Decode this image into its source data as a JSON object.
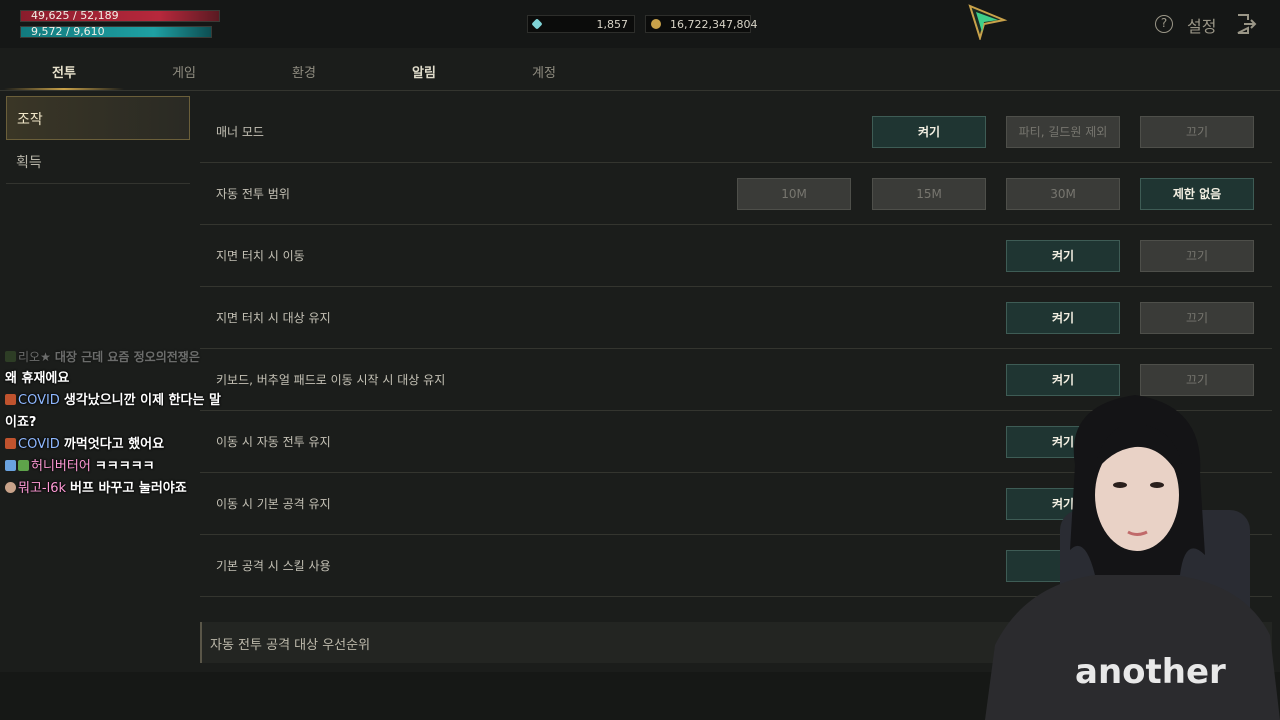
{
  "hud": {
    "hp": "49,625 / 52,189",
    "mp": "9,572 / 9,610",
    "diamonds": "1,857",
    "gold": "16,722,347,804",
    "help_glyph": "?",
    "settings_title": "설정"
  },
  "tabs": [
    "전투",
    "게임",
    "환경",
    "알림",
    "계정"
  ],
  "submenu": [
    "조작",
    "획득"
  ],
  "rows": [
    {
      "label": "매너 모드",
      "options": [
        "켜기",
        "파티, 길드원 제외",
        "끄기"
      ]
    },
    {
      "label": "자동 전투 범위",
      "options": [
        "10M",
        "15M",
        "30M",
        "제한 없음"
      ]
    },
    {
      "label": "지면 터치 시 이동",
      "options": [
        "켜기",
        "끄기"
      ]
    },
    {
      "label": "지면 터치 시 대상 유지",
      "options": [
        "켜기",
        "끄기"
      ]
    },
    {
      "label": "키보드, 버추얼 패드로 이동 시작 시 대상 유지",
      "options": [
        "켜기",
        "끄기"
      ]
    },
    {
      "label": "이동 시 자동 전투 유지",
      "options": [
        "켜기"
      ]
    },
    {
      "label": "이동 시 기본 공격 유지",
      "options": [
        "켜기"
      ]
    },
    {
      "label": "기본 공격 시 스킬 사용",
      "options": []
    }
  ],
  "section_label": "자동 전투 공격 대상 우선순위",
  "chat": [
    {
      "nick": "",
      "msg": "왜 휴재에요",
      "nick_color": "#ffffff"
    },
    {
      "nick": "COVID",
      "msg": "생각났으니깐 이제 한다는 말",
      "nick_color": "#8fb8ff"
    },
    {
      "nick": "",
      "msg": "이죠?",
      "nick_color": "#ffffff"
    },
    {
      "nick": "COVID",
      "msg": "까먹엇다고 했어요",
      "nick_color": "#8fb8ff"
    },
    {
      "nick": "허니버터어",
      "msg": "ㅋㅋㅋㅋㅋ",
      "nick_color": "#ff9ad6"
    },
    {
      "nick": "뭐고-l6k",
      "msg": "버프 바꾸고 눌러야죠",
      "nick_color": "#ff9ad6"
    }
  ],
  "chat_faded": {
    "nick": "리오★",
    "msg": "대장 근데 요즘 정오의전쟁은"
  },
  "shirt_text": "another",
  "colors": {
    "accent_on": "#1f3532",
    "accent_gold": "#c9a24a",
    "hp": "#b7283c",
    "mp": "#1ea0a3"
  }
}
